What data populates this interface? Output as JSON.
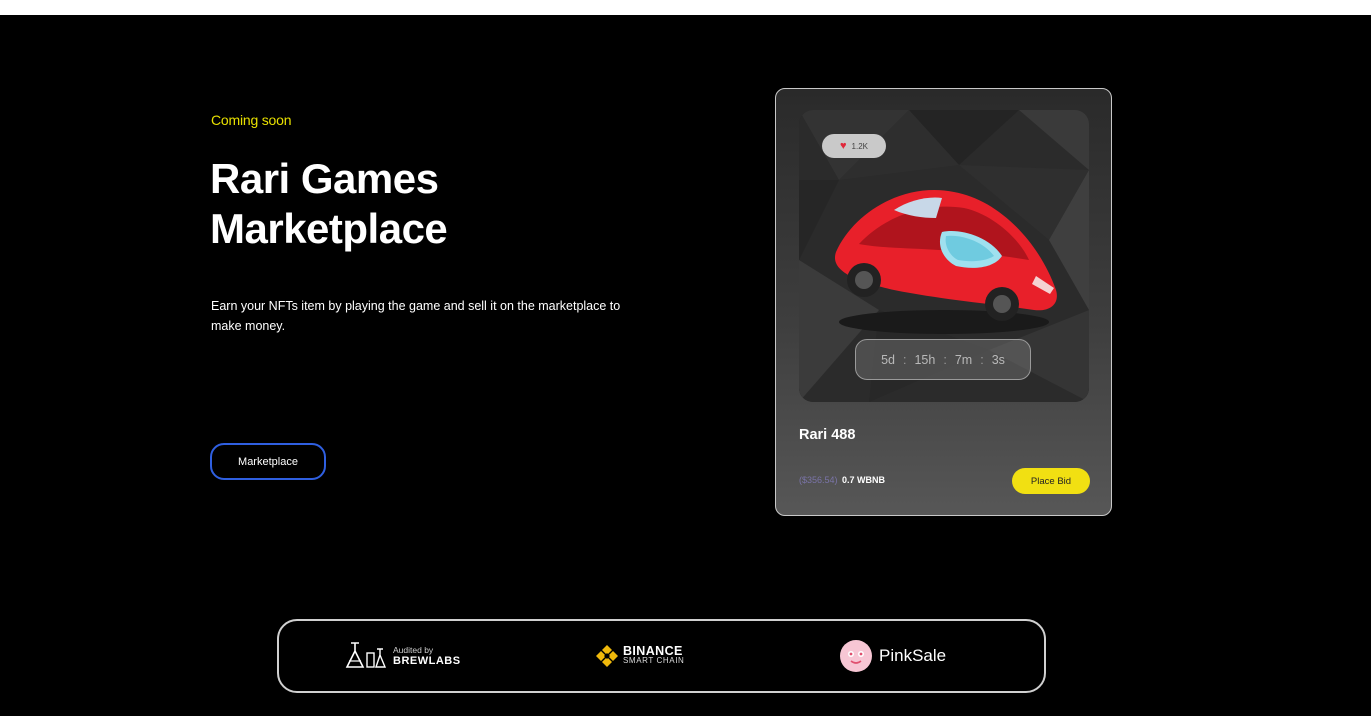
{
  "hero": {
    "eyebrow": "Coming soon",
    "title_line1": "Rari Games",
    "title_line2": "Marketplace",
    "description_line1": "Earn your NFTs item by playing the game and sell it on the marketplace to",
    "description_line2": "make money.",
    "cta_label": "Marketplace"
  },
  "card": {
    "likes": "1.2K",
    "countdown": {
      "days": "5d",
      "hours": "15h",
      "minutes": "7m",
      "seconds": "3s",
      "separator": ":"
    },
    "name": "Rari 488",
    "price_usd": "($356.54)",
    "price_token": "0.7 WBNB",
    "bid_label": "Place Bid"
  },
  "partners": {
    "brewlabs": {
      "line1": "Audited by",
      "line2": "BREWLABS"
    },
    "binance": {
      "line1": "BINANCE",
      "line2": "SMART CHAIN"
    },
    "pinksale": {
      "name": "PinkSale"
    }
  },
  "colors": {
    "accent_yellow": "#e8e000",
    "button_border_blue": "#2f5fe0",
    "bid_yellow": "#f1e012",
    "heart_red": "#e0283a",
    "car_red": "#e8202a",
    "binance_gold": "#f0b90b",
    "pinksale_pink": "#f7c6d4"
  }
}
